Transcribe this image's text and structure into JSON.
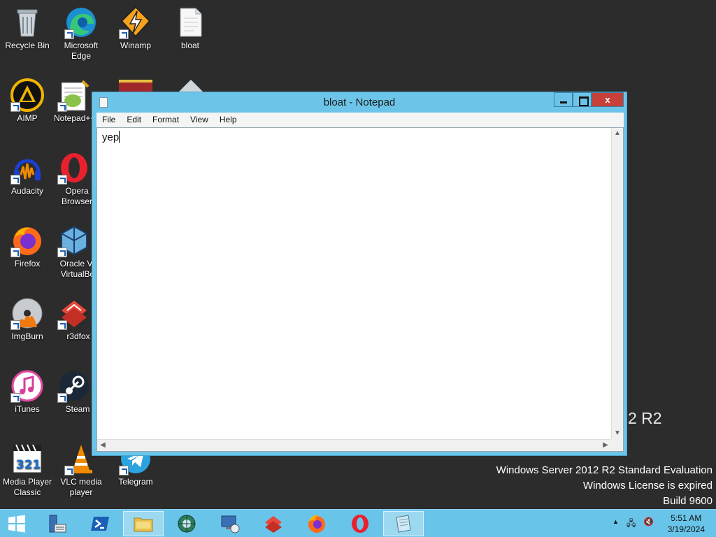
{
  "desktop": {
    "icons": [
      {
        "label": "Recycle Bin"
      },
      {
        "label": "Microsoft Edge"
      },
      {
        "label": "Winamp"
      },
      {
        "label": "bloat"
      },
      {
        "label": "AIMP"
      },
      {
        "label": "Notepad++"
      },
      {
        "label": "Audacity"
      },
      {
        "label": "Opera Browser"
      },
      {
        "label": "Firefox"
      },
      {
        "label": "Oracle VM VirtualBox"
      },
      {
        "label": "ImgBurn"
      },
      {
        "label": "r3dfox"
      },
      {
        "label": "iTunes"
      },
      {
        "label": "Steam"
      },
      {
        "label": "Media Player Classic"
      },
      {
        "label": "VLC media player"
      },
      {
        "label": "Telegram"
      }
    ],
    "watermark": {
      "edition": "Windows Server 2012 R2 Standard Evaluation",
      "license": "Windows License is expired",
      "build": "Build 9600",
      "r2_fragment": "2 R2"
    }
  },
  "window": {
    "title": "bloat - Notepad",
    "controls": {
      "minimize": "",
      "maximize": "",
      "close": "x"
    },
    "menu": [
      "File",
      "Edit",
      "Format",
      "View",
      "Help"
    ],
    "content": "yep"
  },
  "taskbar": {
    "items": [
      "start",
      "server-manager",
      "powershell",
      "file-explorer",
      "network-app",
      "remote-desktop",
      "r3dfox",
      "firefox",
      "opera",
      "notepad"
    ],
    "active": "notepad",
    "clock": {
      "time": "5:51 AM",
      "date": "3/19/2024"
    }
  },
  "colors": {
    "desktop": "#2c2c2c",
    "accent": "#69c4ea",
    "close": "#c7403a"
  }
}
